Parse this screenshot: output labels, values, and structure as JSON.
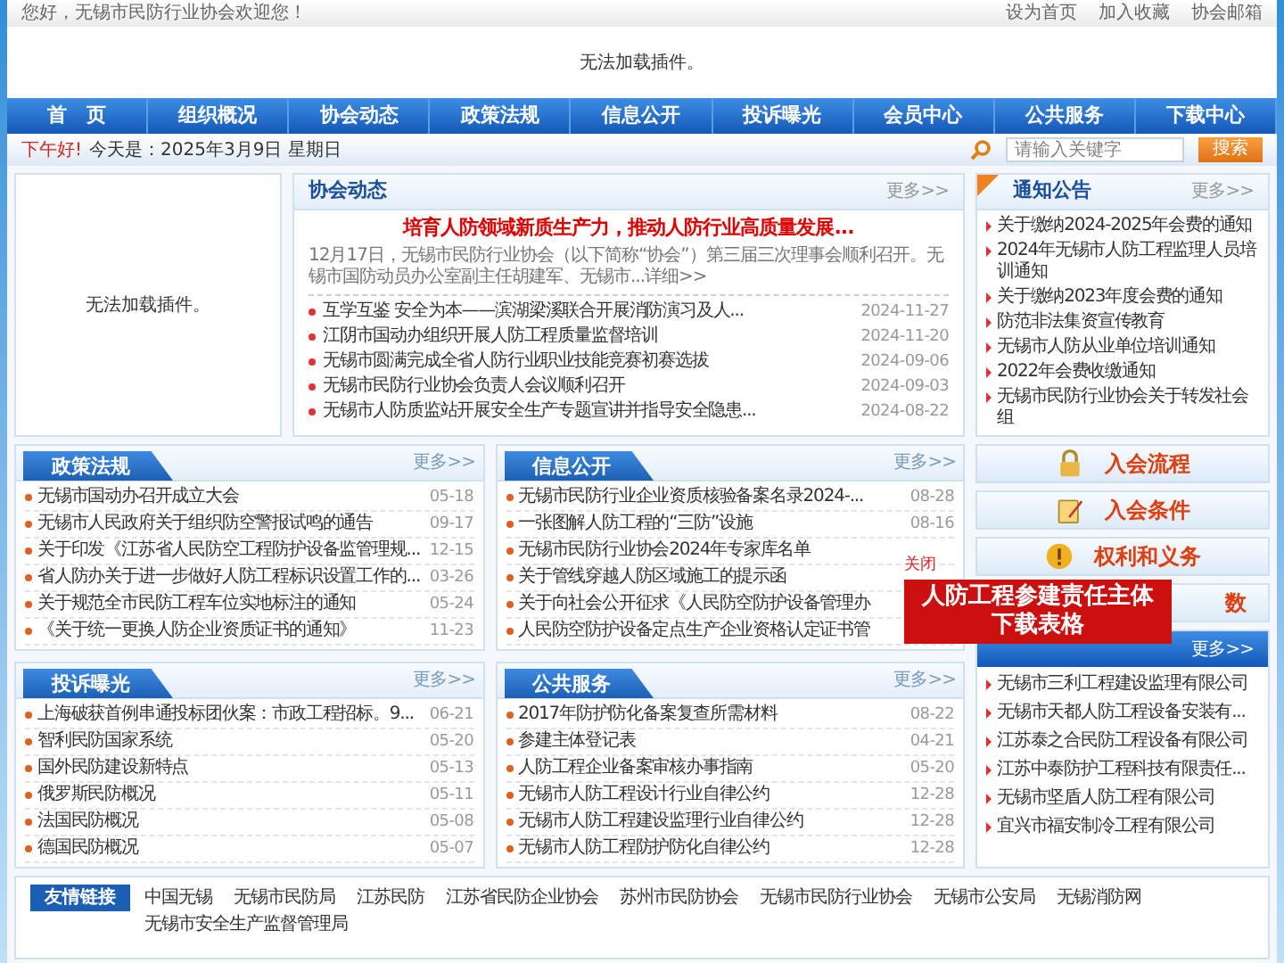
{
  "top_bar": {
    "greeting": "您好，无锡市民防行业协会欢迎您！",
    "links": [
      "设为首页",
      "加入收藏",
      "协会邮箱"
    ]
  },
  "banner": {
    "message": "无法加载插件。"
  },
  "nav": [
    "首　页",
    "组织概况",
    "协会动态",
    "政策法规",
    "信息公开",
    "投诉曝光",
    "会员中心",
    "公共服务",
    "下载中心"
  ],
  "date_bar": {
    "greeting": "下午好!",
    "today": "今天是：2025年3月9日 星期日",
    "search": {
      "placeholder": "请输入关键字"
    },
    "search_button": "搜索"
  },
  "plugin_box": {
    "message": "无法加载插件。"
  },
  "news": {
    "title": "协会动态",
    "more": "更多>>",
    "headline": "培育人防领域新质生产力，推动人防行业高质量发展...",
    "summary": "12月17日，无锡市民防行业协会（以下简称“协会”）第三届三次理事会顺利召开。无锡市国防动员办公室副主任胡建军、无锡市...",
    "summary_link": "详细>>",
    "items": [
      {
        "title": "互学互鉴 安全为本——滨湖梁溪联合开展消防演习及人...",
        "date": "2024-11-27"
      },
      {
        "title": "江阴市国动办组织开展人防工程质量监督培训",
        "date": "2024-11-20"
      },
      {
        "title": "无锡市圆满完成全省人防行业职业技能竞赛初赛选拔",
        "date": "2024-09-06"
      },
      {
        "title": "无锡市民防行业协会负责人会议顺利召开",
        "date": "2024-09-03"
      },
      {
        "title": "无锡市人防质监站开展安全生产专题宣讲并指导安全隐患...",
        "date": "2024-08-22"
      }
    ]
  },
  "notices": {
    "title": "通知公告",
    "more": "更多>>",
    "items": [
      "关于缴纳2024-2025年会费的通知",
      "2024年无锡市人防工程监理人员培训通知",
      "关于缴纳2023年度会费的通知",
      "防范非法集资宣传教育",
      "无锡市人防从业单位培训通知",
      "2022年会费收缴通知",
      "无锡市民防行业协会关于转发社会组"
    ]
  },
  "lists": [
    {
      "title": "政策法规",
      "more": "更多>>",
      "items": [
        {
          "title": "无锡市国动办召开成立大会",
          "date": "05-18"
        },
        {
          "title": "无锡市人民政府关于组织防空警报试鸣的通告",
          "date": "09-17"
        },
        {
          "title": "关于印发《江苏省人民防空工程防护设备监管理规...",
          "date": "12-15"
        },
        {
          "title": "省人防办关于进一步做好人防工程标识设置工作的...",
          "date": "03-26"
        },
        {
          "title": "关于规范全市民防工程车位实地标注的通知",
          "date": "05-24"
        },
        {
          "title": "《关于统一更换人防企业资质证书的通知》",
          "date": "11-23"
        }
      ]
    },
    {
      "title": "信息公开",
      "more": "更多>>",
      "items": [
        {
          "title": "无锡市民防行业企业资质核验备案名录2024-...",
          "date": "08-28"
        },
        {
          "title": "一张图解人防工程的“三防”设施",
          "date": "08-16"
        },
        {
          "title": "无锡市民防行业协会2024年专家库名单"
        },
        {
          "title": "关于管线穿越人防区域施工的提示函"
        },
        {
          "title": "关于向社会公开征求《人民防空防护设备管理办"
        },
        {
          "title": "人民防空防护设备定点生产企业资格认定证书管"
        }
      ]
    },
    {
      "title": "投诉曝光",
      "more": "更多>>",
      "items": [
        {
          "title": "上海破获首例串通投标团伙案：市政工程招标。9...",
          "date": "06-21"
        },
        {
          "title": "智利民防国家系统",
          "date": "05-20"
        },
        {
          "title": "国外民防建设新特点",
          "date": "05-13"
        },
        {
          "title": "俄罗斯民防概况",
          "date": "05-11"
        },
        {
          "title": "法国民防概况",
          "date": "05-08"
        },
        {
          "title": "德国民防概况",
          "date": "05-07"
        }
      ]
    },
    {
      "title": "公共服务",
      "more": "更多>>",
      "items": [
        {
          "title": "2017年防护防化备案复查所需材料",
          "date": "08-22"
        },
        {
          "title": "参建主体登记表",
          "date": "04-21"
        },
        {
          "title": "人防工程企业备案审核办事指南",
          "date": "05-20"
        },
        {
          "title": "无锡市人防工程设计行业自律公约",
          "date": "12-28"
        },
        {
          "title": "无锡市人防工程建设监理行业自律公约",
          "date": "12-28"
        },
        {
          "title": "无锡市人防工程防护防化自律公约",
          "date": "12-28"
        }
      ]
    }
  ],
  "member_links": [
    "入会流程",
    "入会条件",
    "权利和义务",
    "数"
  ],
  "members": {
    "more": "更多>>",
    "items": [
      "无锡市三利工程建设监理有限公司",
      "无锡市天都人防工程设备安装有...",
      "江苏泰之合民防工程设备有限公司",
      "江苏中泰防护工程科技有限责任...",
      "无锡市坚盾人防工程有限公司",
      "宜兴市福安制冷工程有限公司"
    ]
  },
  "popup": {
    "close": "关闭",
    "lines": [
      "人防工程参建责任主体",
      "下载表格"
    ]
  },
  "friend_links": {
    "title": "友情链接",
    "links": [
      "中国无锡",
      "无锡市民防局",
      "江苏民防",
      "江苏省民防企业协会",
      "苏州市民防协会",
      "无锡市民防行业协会",
      "无锡市公安局",
      "无锡消防网",
      "无锡市安全生产监督管理局"
    ]
  }
}
